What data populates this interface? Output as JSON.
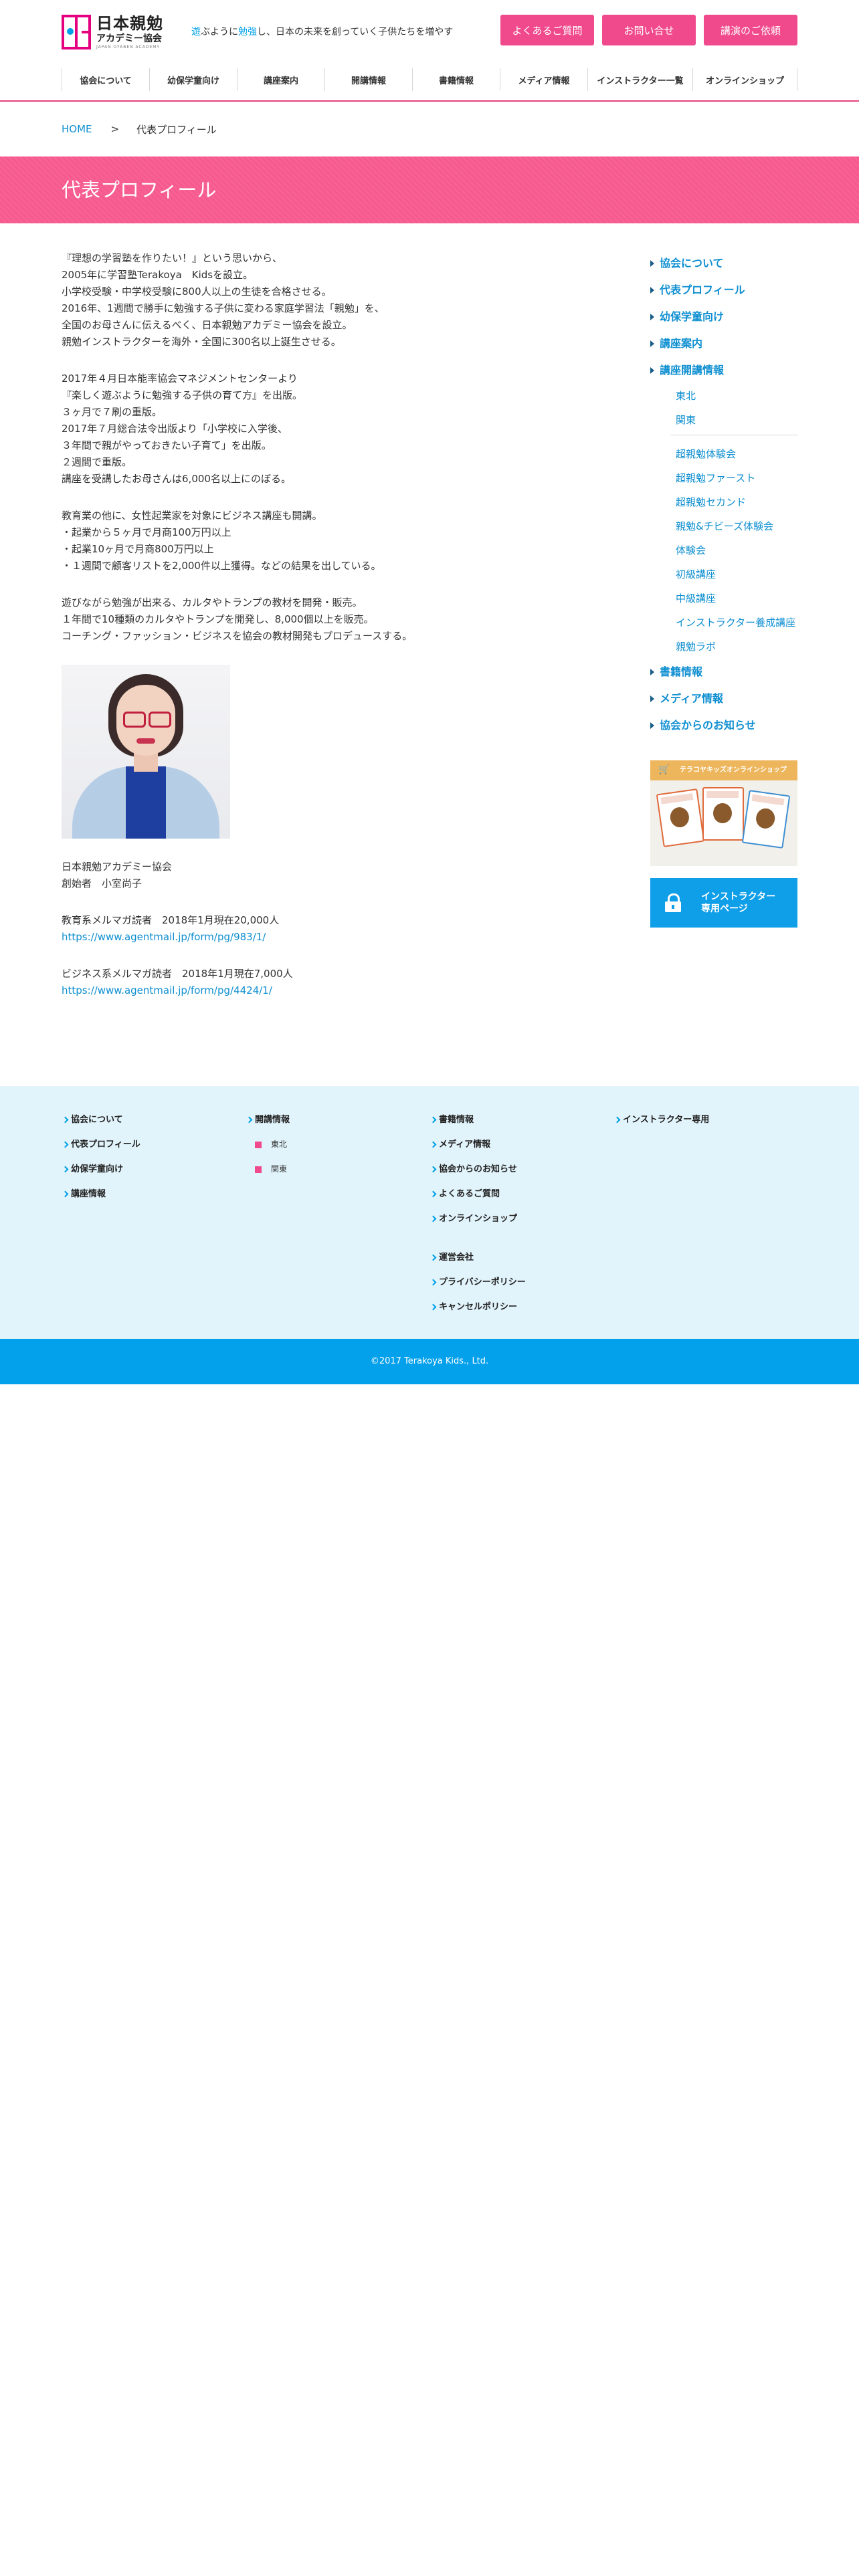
{
  "header": {
    "logo_main": "日本親勉",
    "logo_sub": "アカデミー協会",
    "logo_en": "JAPAN OYABEN ACADEMY",
    "tagline": {
      "p1": "遊",
      "p2": "ぶように",
      "p3": "勉強",
      "p4": "し、日本の未来を創っていく子供たちを増やす"
    },
    "buttons": [
      "よくあるご質問",
      "お問い合せ",
      "講演のご依頼"
    ]
  },
  "nav": [
    "協会について",
    "幼保学童向け",
    "講座案内",
    "開講情報",
    "書籍情報",
    "メディア情報",
    "インストラクター一覧",
    "オンラインショップ"
  ],
  "breadcrumb": {
    "home": "HOME",
    "sep": ">",
    "current": "代表プロフィール"
  },
  "page_title": "代表プロフィール",
  "main": {
    "p1": [
      "『理想の学習塾を作りたい！』という思いから、",
      "2005年に学習塾Terakoya　Kidsを設立。",
      "小学校受験・中学校受験に800人以上の生徒を合格させる。",
      "2016年、1週間で勝手に勉強する子供に変わる家庭学習法「親勉」を、",
      "全国のお母さんに伝えるべく、日本親勉アカデミー協会を設立。",
      "親勉インストラクターを海外・全国に300名以上誕生させる。"
    ],
    "p2": [
      "2017年４月日本能率協会マネジメントセンターより",
      "『楽しく遊ぶように勉強する子供の育て方』を出版。",
      "３ヶ月で７刷の重版。",
      "2017年７月総合法令出版より「小学校に入学後、",
      "３年間で親がやっておきたい子育て」を出版。",
      "２週間で重版。",
      "講座を受講したお母さんは6,000名以上にのぼる。"
    ],
    "p3": [
      "教育業の他に、女性起業家を対象にビジネス講座も開講。",
      "・起業から５ヶ月で月商100万円以上",
      "・起業10ヶ月で月商800万円以上",
      "・１週間で顧客リストを2,000件以上獲得。などの結果を出している。"
    ],
    "p4": [
      "遊びながら勉強が出来る、カルタやトランプの教材を開発・販売。",
      "１年間で10種類のカルタやトランプを開発し、8,000個以上を販売。",
      "コーチング・ファッション・ビジネスを協会の教材開発もプロデュースする。"
    ],
    "org": "日本親勉アカデミー協会",
    "founder": "創始者　小室尚子",
    "edu_mag": "教育系メルマガ読者　2018年1月現在20,000人",
    "edu_link": "https://www.agentmail.jp/form/pg/983/1/",
    "biz_mag": "ビジネス系メルマガ読者　2018年1月現在7,000人",
    "biz_link": "https://www.agentmail.jp/form/pg/4424/1/"
  },
  "sidebar": {
    "items_top": [
      "協会について",
      "代表プロフィール",
      "幼保学童向け",
      "講座案内",
      "講座開講情報"
    ],
    "regions": [
      "東北",
      "関東"
    ],
    "courses": [
      "超親勉体験会",
      "超親勉ファースト",
      "超親勉セカンド",
      "親勉&チビーズ体験会",
      "体験会",
      "初級講座",
      "中級講座",
      "インストラクター養成講座",
      "親勉ラボ"
    ],
    "items_bottom": [
      "書籍情報",
      "メディア情報",
      "協会からのお知らせ"
    ],
    "shop_banner": "テラコヤキッズオンラインショップ",
    "instructor_banner": [
      "インストラクター",
      "専用ページ"
    ]
  },
  "footer": {
    "col1": [
      "協会について",
      "代表プロフィール",
      "幼保学童向け",
      "講座情報"
    ],
    "col2_head": "開講情報",
    "col2_sub": [
      "東北",
      "関東"
    ],
    "col3a": [
      "書籍情報",
      "メディア情報",
      "協会からのお知らせ",
      "よくあるご質問",
      "オンラインショップ"
    ],
    "col3b": [
      "運営会社",
      "プライバシーポリシー",
      "キャンセルポリシー"
    ],
    "col4": [
      "インストラクター専用"
    ],
    "copyright": "©2017 Terakoya Kids., Ltd."
  },
  "colors": {
    "pink": "#f0498c",
    "title_band": "#f75a8f",
    "blue": "#0f8fd1",
    "footer_bg": "#e2f4fb",
    "copyright_bg": "#03a0ec"
  }
}
